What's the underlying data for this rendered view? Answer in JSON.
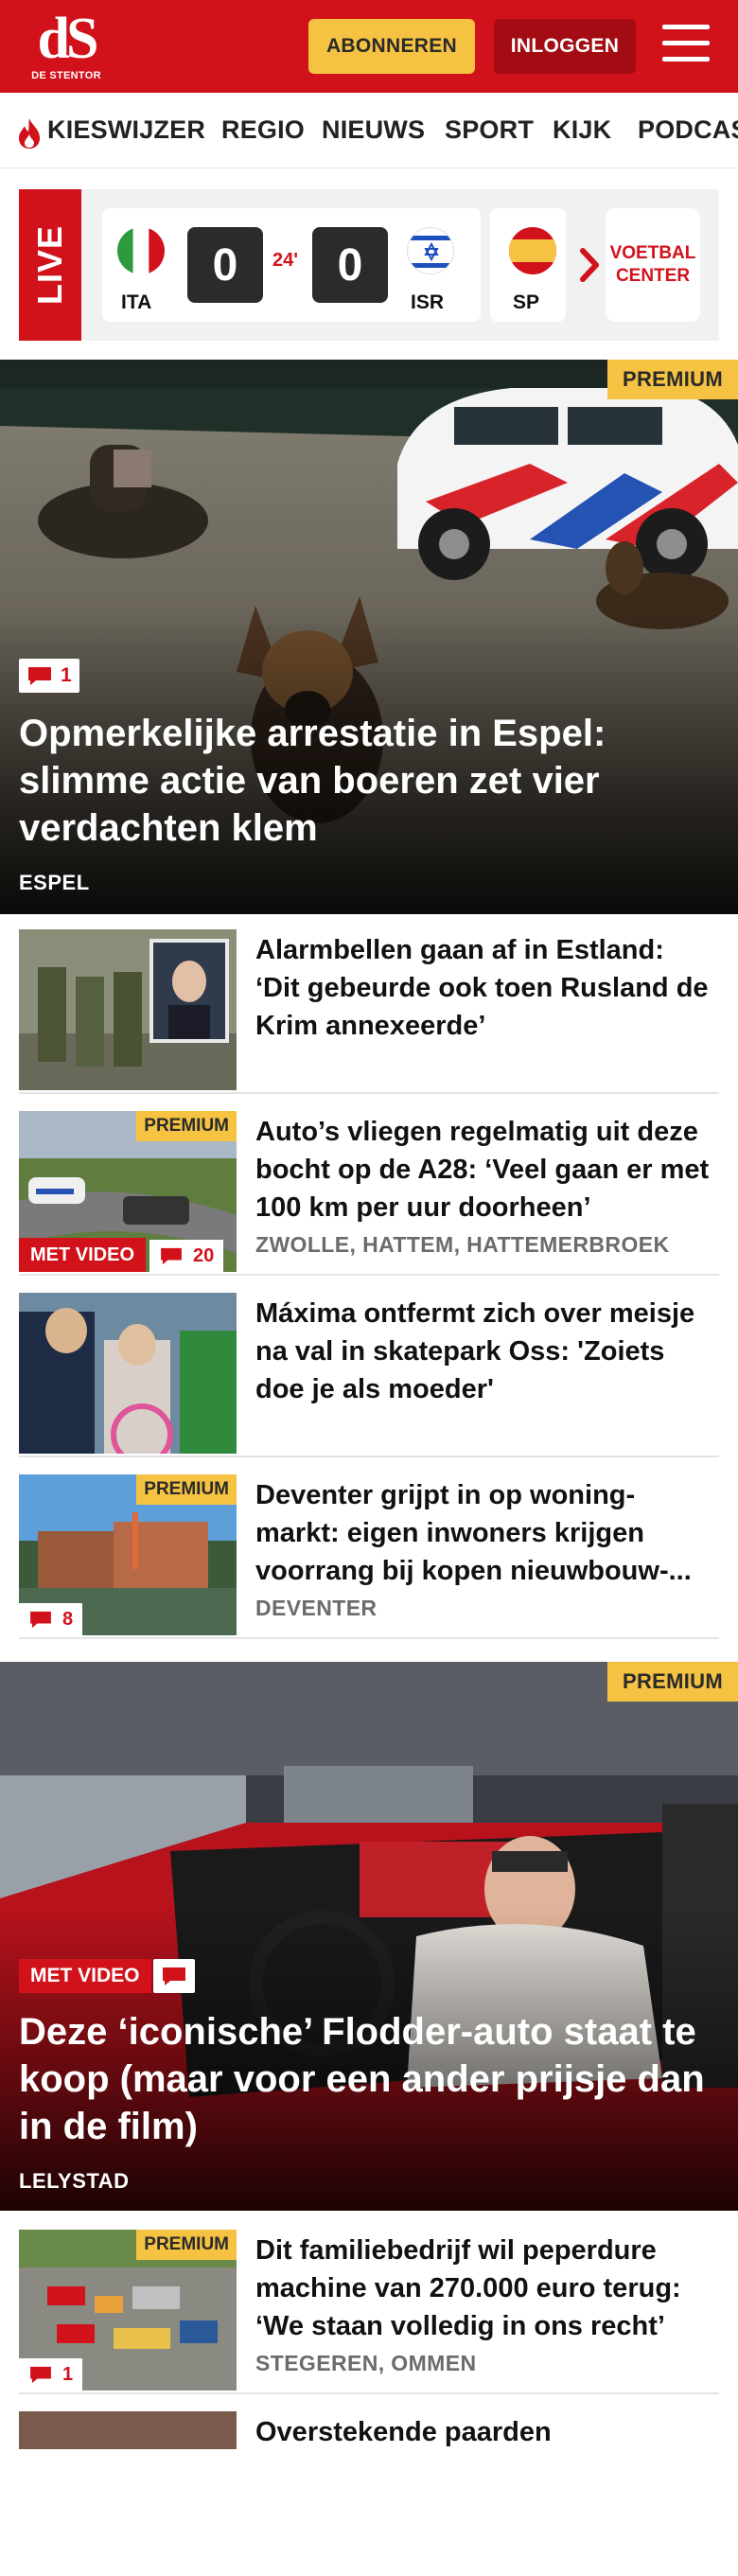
{
  "header": {
    "logo_mark": "dS",
    "logo_sub": "DE STENTOR",
    "subscribe_label": "ABONNEREN",
    "login_label": "INLOGGEN",
    "brand_color": "#d2121b",
    "accent_color": "#f5c242"
  },
  "nav": {
    "items": [
      "KIESWIJZER",
      "REGIO",
      "NIEUWS",
      "SPORT",
      "KIJK",
      "PODCAS"
    ]
  },
  "live": {
    "label": "LIVE",
    "match": {
      "home_code": "ITA",
      "home_score": "0",
      "minute": "24'",
      "away_score": "0",
      "away_code": "ISR"
    },
    "next_code": "SP",
    "center_label": "VOETBAL CENTER"
  },
  "hero1": {
    "premium": "PREMIUM",
    "comments": "1",
    "title": "Opmerkelijke arrestatie in Espel: slimme actie van boeren zet vier verdachten klem",
    "location": "ESPEL"
  },
  "articles": [
    {
      "title": "Alarmbellen gaan af in Estland: ‘Dit gebeurde ook toen Rusland de Krim annexeerde’",
      "location": ""
    },
    {
      "premium": "PREMIUM",
      "video": "MET VIDEO",
      "comments": "20",
      "title": "Auto’s vliegen regelmatig uit deze bocht op de A28: ‘Veel gaan er met 100 km per uur doorheen’",
      "location": "ZWOLLE, HATTEM, HATTEMERBROEK"
    },
    {
      "title": "Máxima ontfermt zich over meisje na val in skatepark Oss: 'Zoiets doe je als moeder'",
      "location": ""
    },
    {
      "premium": "PREMIUM",
      "comments": "8",
      "title": "Deventer grijpt in op woning­markt: eigen inwoners krijgen voorrang bij kopen nieuwbouw-...",
      "location": "DEVENTER"
    }
  ],
  "hero2": {
    "premium": "PREMIUM",
    "video": "MET VIDEO",
    "title": "Deze ‘iconische’ Flodder-auto staat te koop (maar voor een ander prijsje dan in de film)",
    "location": "LELYSTAD"
  },
  "article_last": {
    "premium": "PREMIUM",
    "comments": "1",
    "title": "Dit familiebedrijf wil peperdure machine van 270.000 euro terug: ‘We staan volledig in ons recht’",
    "location": "STEGEREN, OMMEN"
  },
  "article_cut": {
    "title": "Overstekende paarden"
  }
}
